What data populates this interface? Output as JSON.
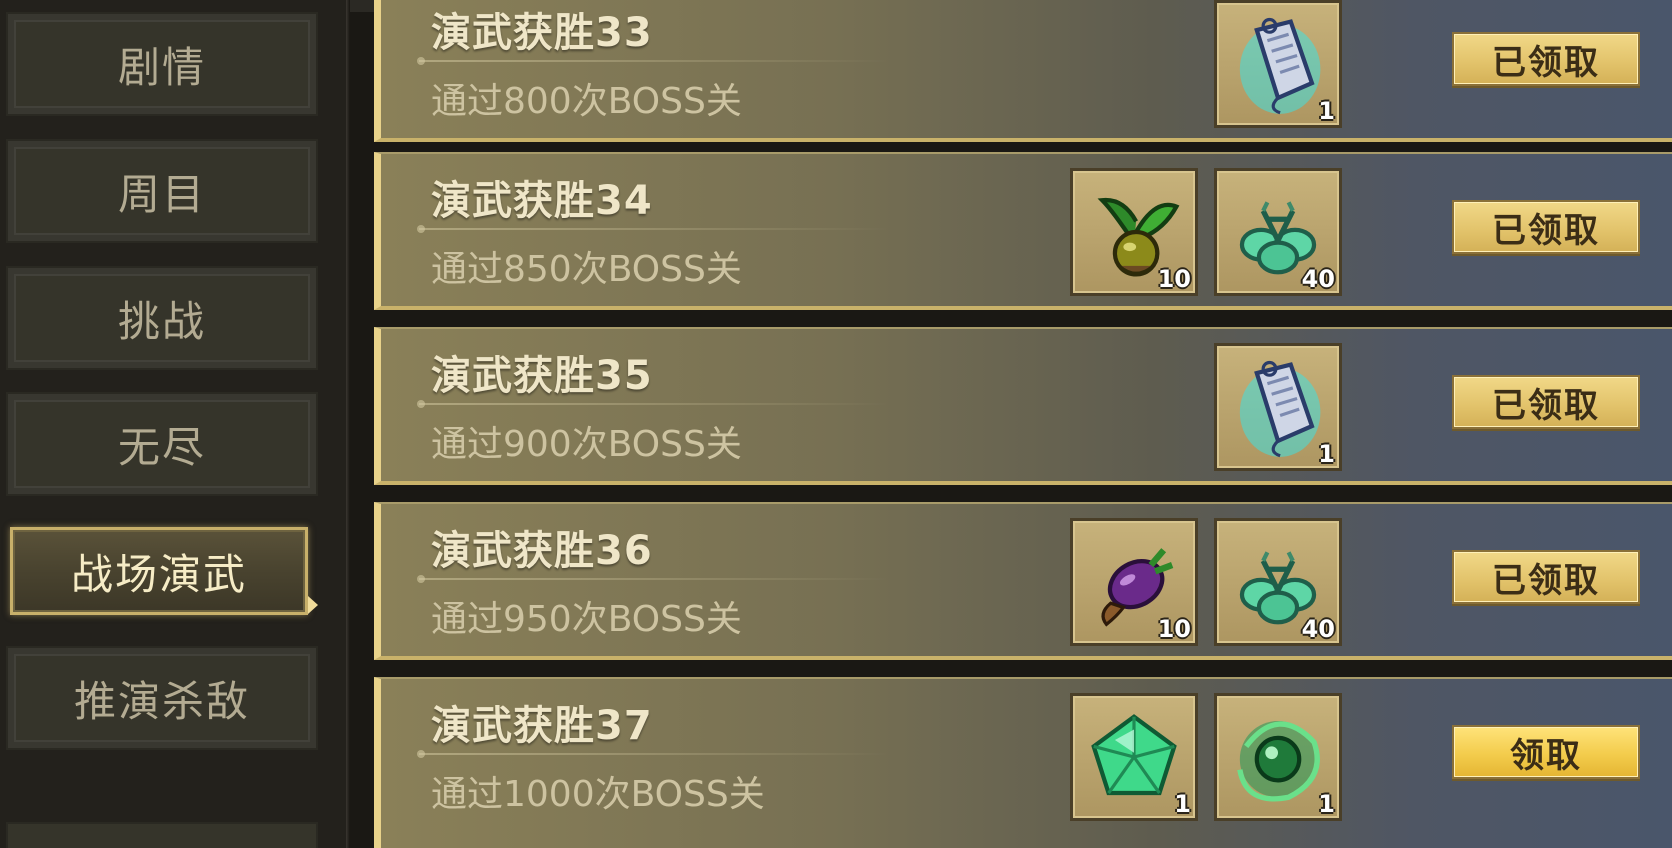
{
  "sidebar": {
    "items": [
      {
        "label": "剧情",
        "active": false
      },
      {
        "label": "周目",
        "active": false
      },
      {
        "label": "挑战",
        "active": false
      },
      {
        "label": "无尽",
        "active": false
      },
      {
        "label": "战场演武",
        "active": true
      },
      {
        "label": "推演杀敌",
        "active": false
      }
    ]
  },
  "achievements": [
    {
      "title": "演武获胜33",
      "description": "通过800次BOSS关",
      "rewards": [
        {
          "icon": "talisman-icon",
          "count": "1"
        }
      ],
      "button_label": "已领取",
      "claimed": true
    },
    {
      "title": "演武获胜34",
      "description": "通过850次BOSS关",
      "rewards": [
        {
          "icon": "seed-sprout-icon",
          "count": "10"
        },
        {
          "icon": "green-clover-icon",
          "count": "40"
        }
      ],
      "button_label": "已领取",
      "claimed": true
    },
    {
      "title": "演武获胜35",
      "description": "通过900次BOSS关",
      "rewards": [
        {
          "icon": "talisman-icon",
          "count": "1"
        }
      ],
      "button_label": "已领取",
      "claimed": true
    },
    {
      "title": "演武获胜36",
      "description": "通过950次BOSS关",
      "rewards": [
        {
          "icon": "eggplant-icon",
          "count": "10"
        },
        {
          "icon": "green-clover-icon",
          "count": "40"
        }
      ],
      "button_label": "已领取",
      "claimed": true
    },
    {
      "title": "演武获胜37",
      "description": "通过1000次BOSS关",
      "rewards": [
        {
          "icon": "emerald-gem-icon",
          "count": "1"
        },
        {
          "icon": "jade-orb-icon",
          "count": "1"
        }
      ],
      "button_label": "领取",
      "claimed": false
    }
  ]
}
